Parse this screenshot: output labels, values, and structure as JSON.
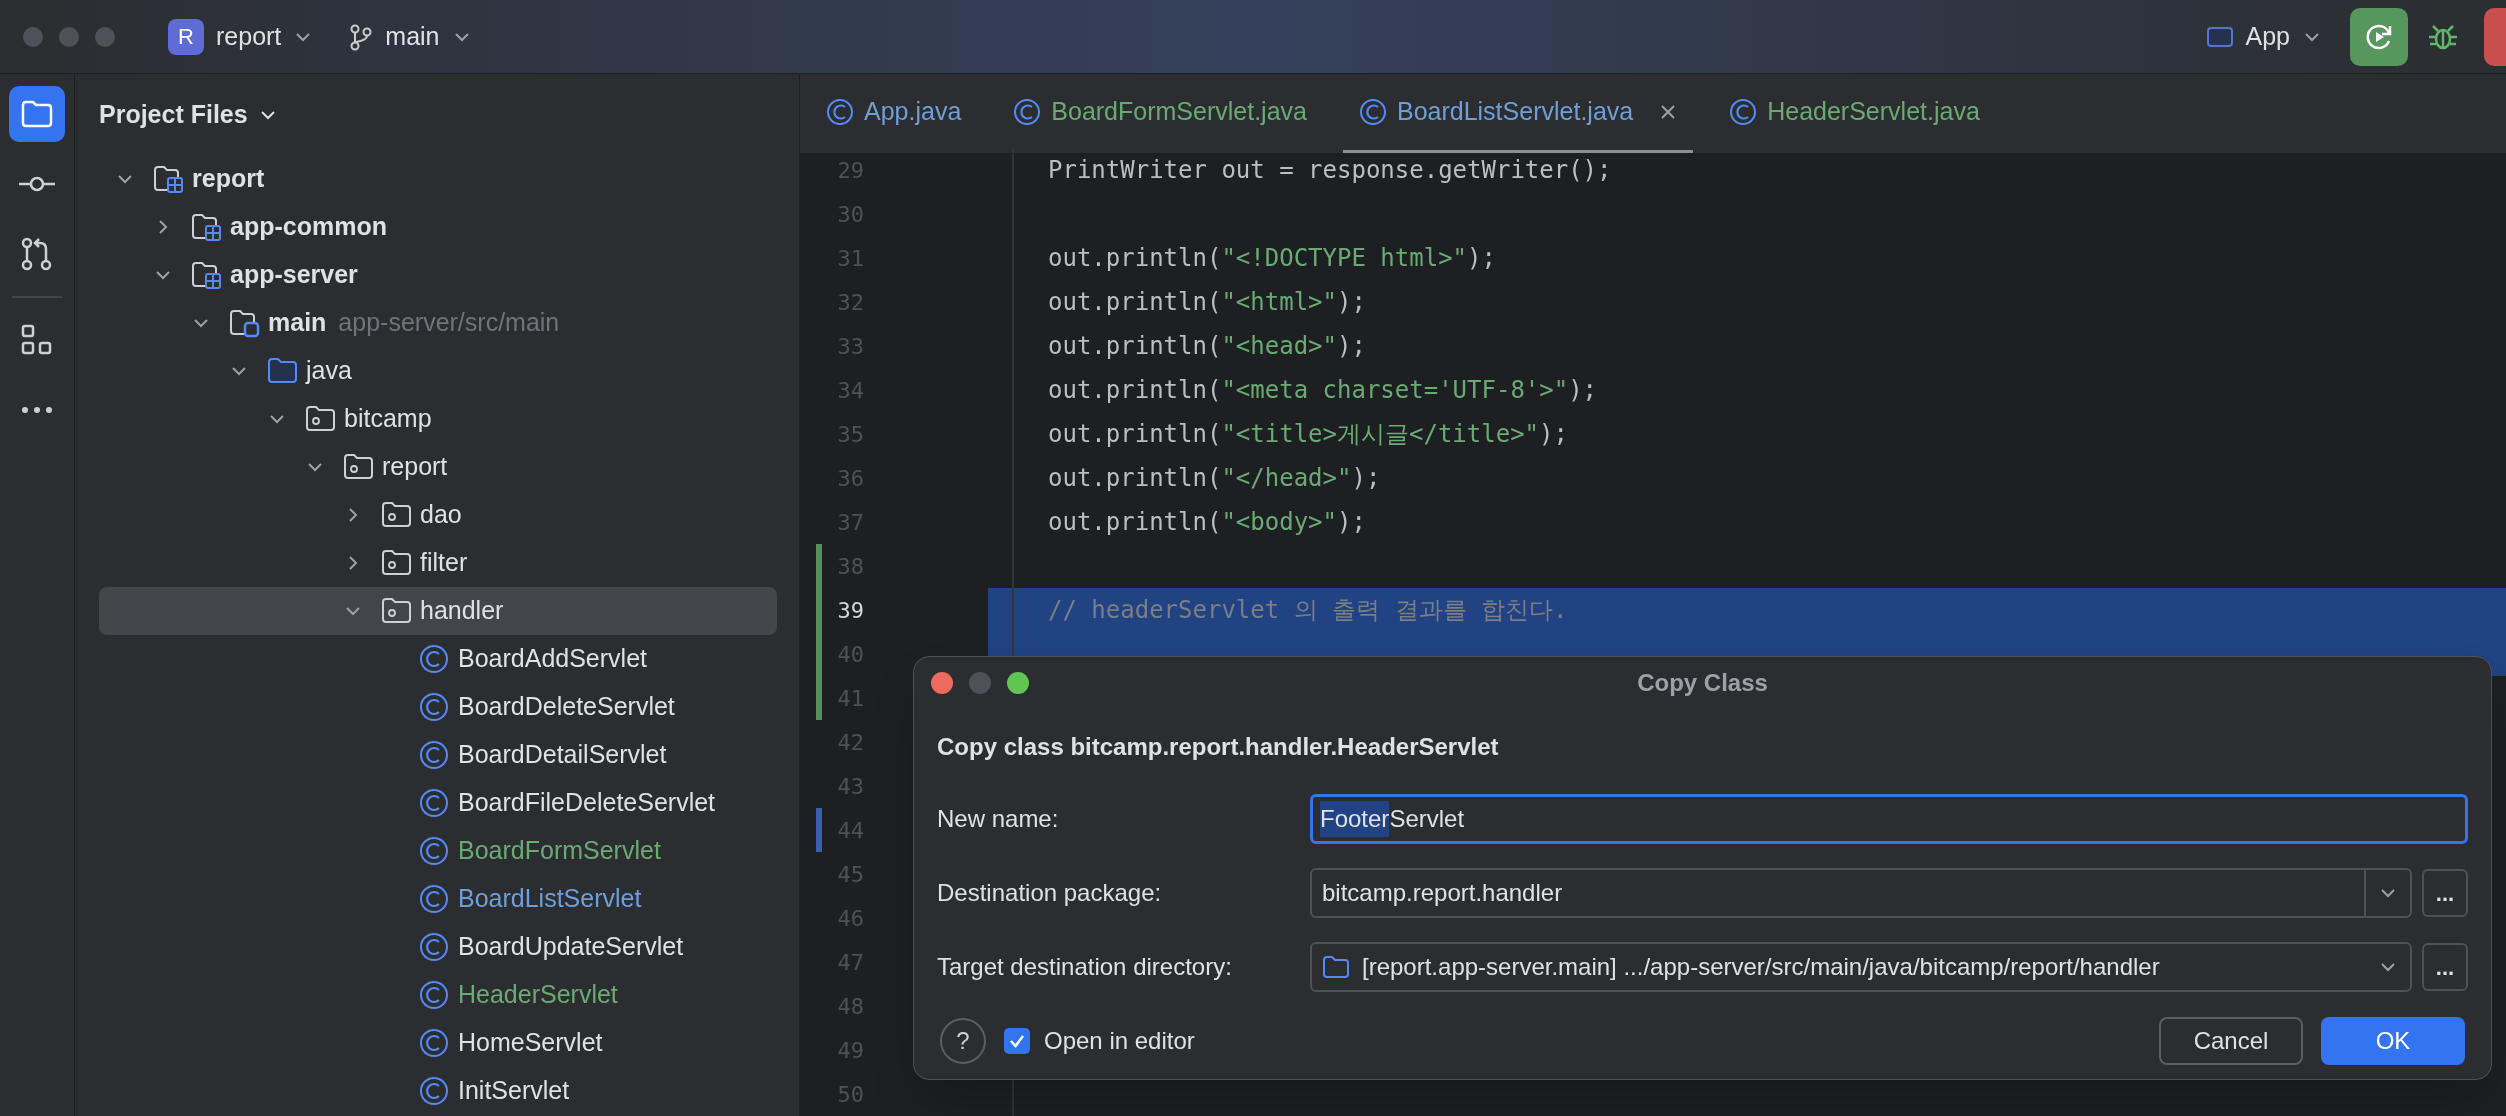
{
  "titlebar": {
    "project_badge": "R",
    "project": "report",
    "branch": "main",
    "run_config": "App"
  },
  "toolstrip": [
    {
      "kind": "folder",
      "selected": true
    },
    {
      "kind": "commit",
      "selected": false
    },
    {
      "kind": "pull-requests",
      "selected": false
    },
    {
      "kind": "divider"
    },
    {
      "kind": "structure",
      "selected": false
    },
    {
      "kind": "more",
      "selected": false
    }
  ],
  "project_panel": {
    "title": "Project Files",
    "tree": [
      {
        "label": "report",
        "kind": "module",
        "expanded": true,
        "selected": false,
        "children": [
          {
            "label": "app-common",
            "kind": "module",
            "expanded": false,
            "selected": false
          },
          {
            "label": "app-server",
            "kind": "module",
            "expanded": true,
            "selected": false,
            "children": [
              {
                "label": "main",
                "hint": "app-server/src/main",
                "kind": "source-set",
                "expanded": true,
                "selected": false,
                "children": [
                  {
                    "label": "java",
                    "kind": "source-root",
                    "expanded": true,
                    "selected": false,
                    "children": [
                      {
                        "label": "bitcamp",
                        "kind": "package",
                        "expanded": true,
                        "selected": false,
                        "children": [
                          {
                            "label": "report",
                            "kind": "package",
                            "expanded": true,
                            "selected": false,
                            "children": [
                              {
                                "label": "dao",
                                "kind": "package",
                                "expanded": false,
                                "selected": false
                              },
                              {
                                "label": "filter",
                                "kind": "package",
                                "expanded": false,
                                "selected": false
                              },
                              {
                                "label": "handler",
                                "kind": "package",
                                "expanded": true,
                                "selected": true,
                                "children": [
                                  {
                                    "label": "BoardAddServlet",
                                    "kind": "class",
                                    "color": "#dfe1e5",
                                    "selected": false
                                  },
                                  {
                                    "label": "BoardDeleteServlet",
                                    "kind": "class",
                                    "color": "#dfe1e5",
                                    "selected": false
                                  },
                                  {
                                    "label": "BoardDetailServlet",
                                    "kind": "class",
                                    "color": "#dfe1e5",
                                    "selected": false
                                  },
                                  {
                                    "label": "BoardFileDeleteServlet",
                                    "kind": "class",
                                    "color": "#dfe1e5",
                                    "selected": false
                                  },
                                  {
                                    "label": "BoardFormServlet",
                                    "kind": "class",
                                    "color": "#6aab73",
                                    "selected": false
                                  },
                                  {
                                    "label": "BoardListServlet",
                                    "kind": "class",
                                    "color": "#6f9fd8",
                                    "selected": false
                                  },
                                  {
                                    "label": "BoardUpdateServlet",
                                    "kind": "class",
                                    "color": "#dfe1e5",
                                    "selected": false
                                  },
                                  {
                                    "label": "HeaderServlet",
                                    "kind": "class",
                                    "color": "#6aab73",
                                    "selected": false
                                  },
                                  {
                                    "label": "HomeServlet",
                                    "kind": "class",
                                    "color": "#dfe1e5",
                                    "selected": false
                                  },
                                  {
                                    "label": "InitServlet",
                                    "kind": "class",
                                    "color": "#dfe1e5",
                                    "selected": false
                                  }
                                ]
                              }
                            ]
                          }
                        ]
                      }
                    ]
                  }
                ]
              }
            ]
          }
        ]
      }
    ]
  },
  "editor": {
    "tabs": [
      {
        "label": "App.java",
        "color": "#6f9fd8",
        "selected": false
      },
      {
        "label": "BoardFormServlet.java",
        "color": "#6aab73",
        "selected": false
      },
      {
        "label": "BoardListServlet.java",
        "color": "#6f9fd8",
        "selected": true
      },
      {
        "label": "HeaderServlet.java",
        "color": "#6aab73",
        "selected": false
      }
    ],
    "lines": [
      {
        "number": "29",
        "current": false,
        "selected": false,
        "segments": [
          {
            "text": "PrintWriter out = response.getWriter();",
            "kind": "plain"
          }
        ]
      },
      {
        "number": "30",
        "current": false,
        "selected": false
      },
      {
        "number": "31",
        "current": false,
        "selected": false,
        "segments": [
          {
            "text": "out.println(",
            "kind": "plain"
          },
          {
            "text": "\"<!DOCTYPE html>\"",
            "kind": "string"
          },
          {
            "text": ");",
            "kind": "plain"
          }
        ]
      },
      {
        "number": "32",
        "current": false,
        "selected": false,
        "segments": [
          {
            "text": "out.println(",
            "kind": "plain"
          },
          {
            "text": "\"<html>\"",
            "kind": "string"
          },
          {
            "text": ");",
            "kind": "plain"
          }
        ]
      },
      {
        "number": "33",
        "current": false,
        "selected": false,
        "segments": [
          {
            "text": "out.println(",
            "kind": "plain"
          },
          {
            "text": "\"<head>\"",
            "kind": "string"
          },
          {
            "text": ");",
            "kind": "plain"
          }
        ]
      },
      {
        "number": "34",
        "current": false,
        "selected": false,
        "segments": [
          {
            "text": "out.println(",
            "kind": "plain"
          },
          {
            "text": "\"<meta charset='UTF-8'>\"",
            "kind": "string"
          },
          {
            "text": ");",
            "kind": "plain"
          }
        ]
      },
      {
        "number": "35",
        "current": false,
        "selected": false,
        "segments": [
          {
            "text": "out.println(",
            "kind": "plain"
          },
          {
            "text": "\"<title>게시글</title>\"",
            "kind": "string"
          },
          {
            "text": ");",
            "kind": "plain"
          }
        ]
      },
      {
        "number": "36",
        "current": false,
        "selected": false,
        "segments": [
          {
            "text": "out.println(",
            "kind": "plain"
          },
          {
            "text": "\"</head>\"",
            "kind": "string"
          },
          {
            "text": ");",
            "kind": "plain"
          }
        ]
      },
      {
        "number": "37",
        "current": false,
        "selected": false,
        "segments": [
          {
            "text": "out.println(",
            "kind": "plain"
          },
          {
            "text": "\"<body>\"",
            "kind": "string"
          },
          {
            "text": ");",
            "kind": "plain"
          }
        ]
      },
      {
        "number": "38",
        "current": false,
        "selected": false,
        "marker": {
          "color": "#549159"
        }
      },
      {
        "number": "39",
        "current": true,
        "selected": true,
        "marker": {
          "color": "#549159"
        },
        "segments": [
          {
            "text": "// headerServlet 의 출력 결과를 합친다.",
            "kind": "comment"
          }
        ]
      },
      {
        "number": "40",
        "current": false,
        "selected": true,
        "marker": {
          "color": "#549159"
        }
      },
      {
        "number": "41",
        "current": false,
        "selected": false,
        "marker": {
          "color": "#549159"
        }
      },
      {
        "number": "42",
        "current": false,
        "selected": false
      },
      {
        "number": "43",
        "current": false,
        "selected": false
      },
      {
        "number": "44",
        "current": false,
        "selected": false,
        "marker": {
          "color": "#375fad"
        }
      },
      {
        "number": "45",
        "current": false,
        "selected": false
      },
      {
        "number": "46",
        "current": false,
        "selected": false
      },
      {
        "number": "47",
        "current": false,
        "selected": false
      },
      {
        "number": "48",
        "current": false,
        "selected": false
      },
      {
        "number": "49",
        "current": false,
        "selected": false
      },
      {
        "number": "50",
        "current": false,
        "selected": false
      }
    ]
  },
  "dialog": {
    "title": "Copy Class",
    "heading": "Copy class bitcamp.report.handler.HeaderServlet",
    "fields": [
      {
        "kind": "text",
        "label": "New name:",
        "focused": true,
        "value": [
          {
            "text": "Footer",
            "selected": true
          },
          {
            "text": "Servlet",
            "selected": false
          }
        ]
      },
      {
        "kind": "combo",
        "label": "Destination package:",
        "focused": false,
        "value": "bitcamp.report.handler",
        "browse": "..."
      },
      {
        "kind": "path",
        "label": "Target destination directory:",
        "focused": false,
        "value": "[report.app-server.main] .../app-server/src/main/java/bitcamp/report/handler",
        "browse": "..."
      }
    ],
    "help": "?",
    "open_in_editor": {
      "label": "Open in editor",
      "checked": true
    },
    "buttons": [
      {
        "label": "Cancel",
        "default": false
      },
      {
        "label": "OK",
        "default": true
      }
    ]
  }
}
